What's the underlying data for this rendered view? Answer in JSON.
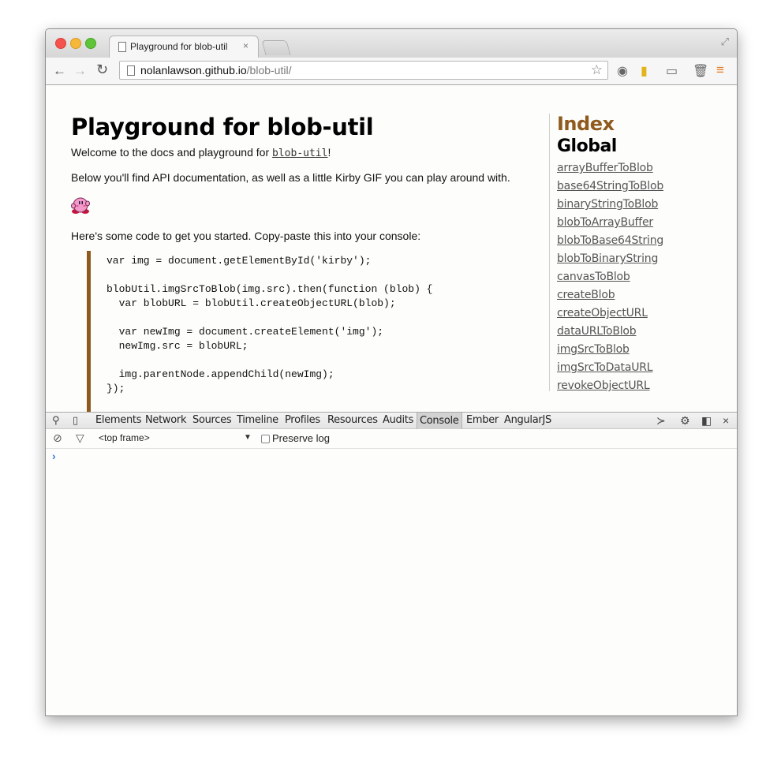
{
  "browser": {
    "tab_title": "Playground for blob-util",
    "tab_close": "×",
    "url_host": "nolanlawson.github.io",
    "url_path": "/blob-util/"
  },
  "page": {
    "title": "Playground for blob-util",
    "intro_prefix": "Welcome to the docs and playground for ",
    "intro_link": "blob-util",
    "intro_suffix": "!",
    "para2": "Below you'll find API documentation, as well as a little Kirby GIF you can play around with.",
    "para3": "Here's some code to get you started. Copy-paste this into your console:",
    "code": "var img = document.getElementById('kirby');\n\nblobUtil.imgSrcToBlob(img.src).then(function (blob) {\n  var blobURL = blobUtil.createObjectURL(blob);\n\n  var newImg = document.createElement('img');\n  newImg.src = blobURL;\n\n  img.parentNode.appendChild(newImg);\n});"
  },
  "sidebar": {
    "index_title": "Index",
    "global_title": "Global",
    "links": [
      "arrayBufferToBlob",
      "base64StringToBlob",
      "binaryStringToBlob",
      "blobToArrayBuffer",
      "blobToBase64String",
      "blobToBinaryString",
      "canvasToBlob",
      "createBlob",
      "createObjectURL",
      "dataURLToBlob",
      "imgSrcToBlob",
      "imgSrcToDataURL",
      "revokeObjectURL"
    ]
  },
  "devtools": {
    "tabs": [
      "Elements",
      "Network",
      "Sources",
      "Timeline",
      "Profiles",
      "Resources",
      "Audits",
      "Console",
      "Ember",
      "AngularJS"
    ],
    "active_tab": "Console",
    "frame_select": "<top frame>",
    "preserve_log": "Preserve log",
    "prompt": "›"
  },
  "colors": {
    "accent": "#8f5a1e",
    "menu": "#e57b21",
    "prompt": "#3a7ad9"
  }
}
